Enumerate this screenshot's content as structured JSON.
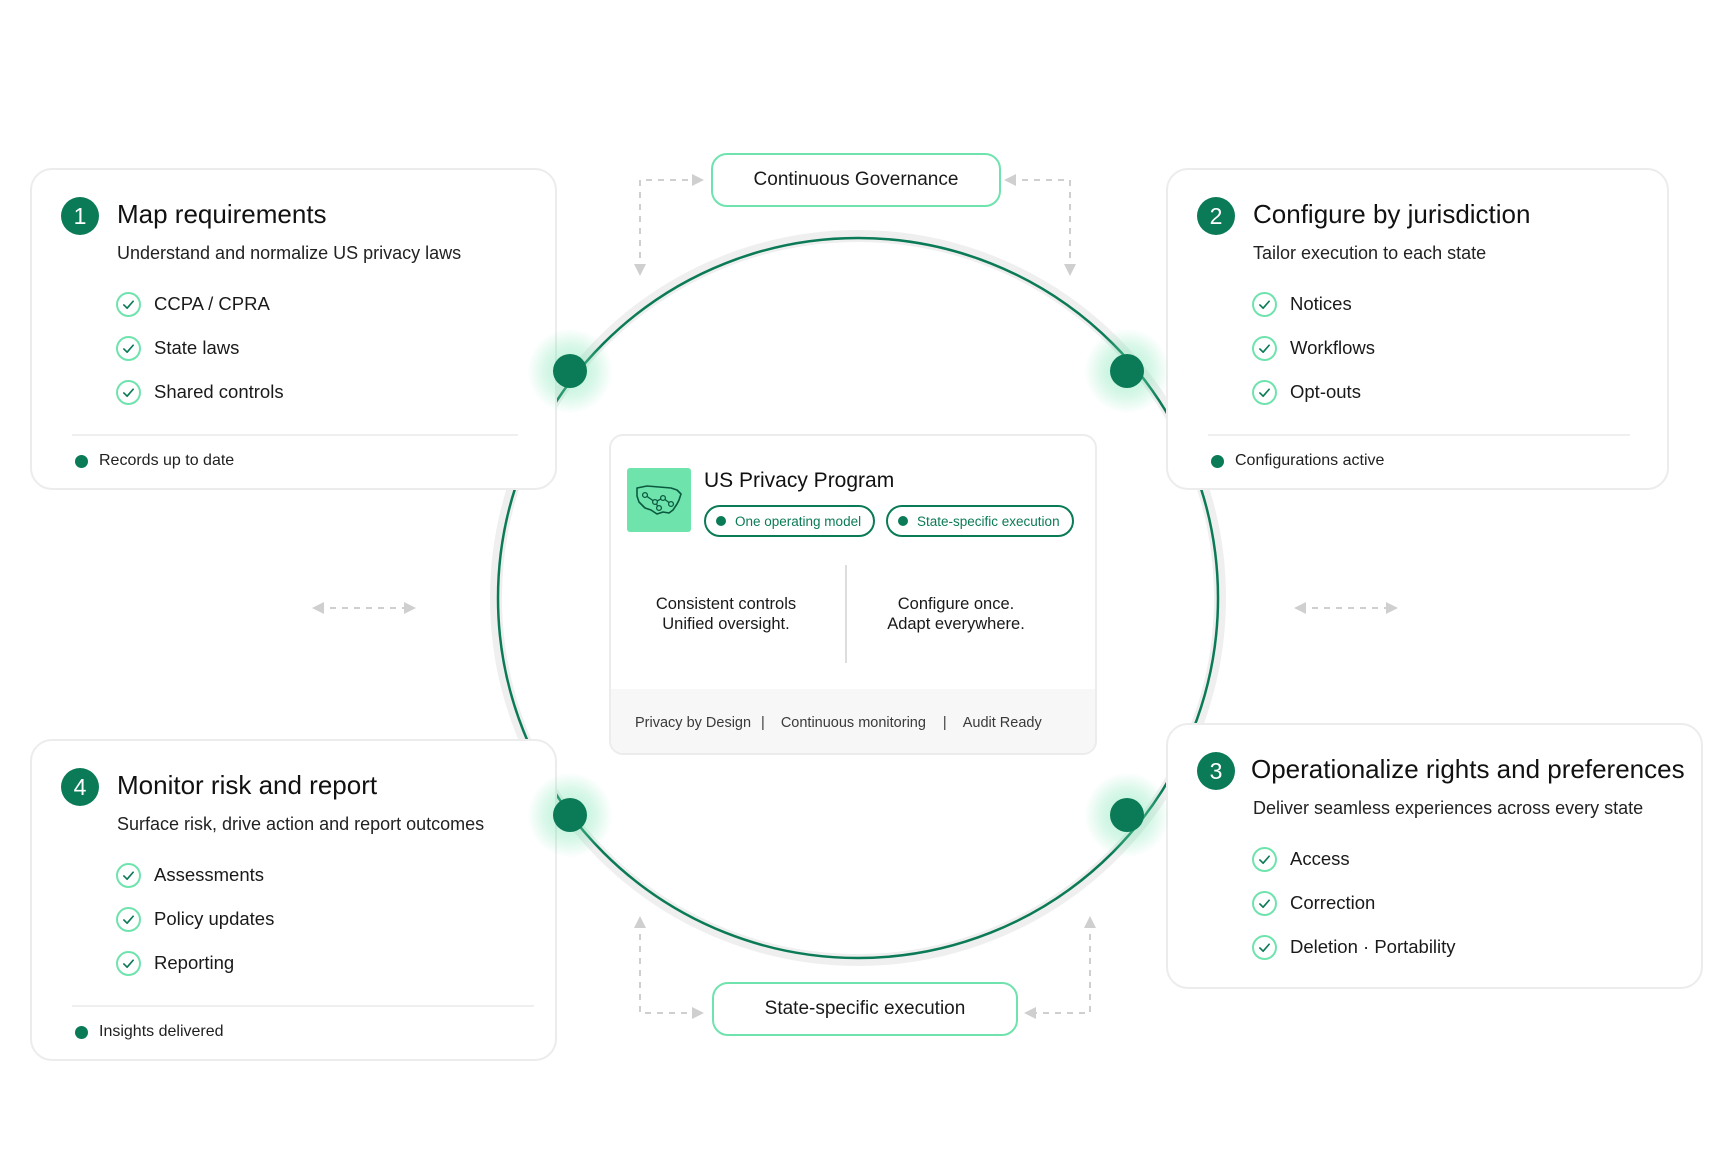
{
  "program": {
    "title": "US Privacy Program",
    "tags": [
      "One operating model",
      "State-specific execution"
    ],
    "left_text": [
      "Consistent controls",
      "Unified oversight."
    ],
    "right_text": [
      "Configure once.",
      "Adapt everywhere."
    ],
    "footer": [
      "Privacy by Design",
      "Continuous monitoring",
      "Audit Ready"
    ],
    "separator": "|",
    "map_icon": "us-map-network-icon"
  },
  "pills": {
    "top": "Continuous Governance",
    "bottom": "State-specific execution"
  },
  "cards": [
    {
      "number": "1",
      "title": "Map requirements",
      "subtitle": "Understand and normalize US privacy laws",
      "items": [
        "CCPA / CPRA",
        "State laws",
        "Shared controls"
      ],
      "status": "Records up to date"
    },
    {
      "number": "2",
      "title": "Configure by jurisdiction",
      "subtitle": "Tailor execution to each state",
      "items": [
        "Notices",
        "Workflows",
        "Opt-outs"
      ],
      "status": "Configurations active"
    },
    {
      "number": "3",
      "title": "Operationalize rights and preferences",
      "subtitle": "Deliver seamless experiences across every state",
      "items": [
        "Access",
        "Correction",
        "Deletion · Portability"
      ]
    },
    {
      "number": "4",
      "title": "Monitor risk and report",
      "subtitle": "Surface risk, drive action and report outcomes",
      "items": [
        "Assessments",
        "Policy updates",
        "Reporting"
      ],
      "status": "Insights delivered"
    }
  ],
  "colors": {
    "accent": "#0b7a57",
    "accent_light": "#6fe3ad",
    "ring": "#ececec"
  }
}
